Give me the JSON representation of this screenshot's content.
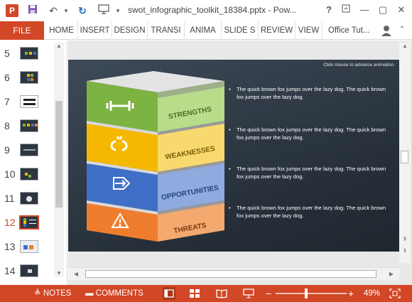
{
  "window": {
    "title": "swot_infographic_toolkit_18384.pptx - Pow...",
    "app_icon_label": "P",
    "quick_access": [
      "save-icon",
      "undo-icon",
      "redo-icon",
      "present-icon"
    ],
    "controls": [
      "help-icon",
      "ribbon-display-icon",
      "minimize-icon",
      "maximize-icon",
      "close-icon"
    ]
  },
  "ribbon": {
    "file_label": "FILE",
    "tabs": [
      "HOME",
      "INSERT",
      "DESIGN",
      "TRANSI",
      "ANIMA",
      "SLIDE S",
      "REVIEW",
      "VIEW"
    ],
    "user": "Office Tut..."
  },
  "thumbnails": {
    "items": [
      {
        "num": "5"
      },
      {
        "num": "6"
      },
      {
        "num": "7"
      },
      {
        "num": "8"
      },
      {
        "num": "9"
      },
      {
        "num": "10"
      },
      {
        "num": "11"
      },
      {
        "num": "12"
      },
      {
        "num": "13"
      },
      {
        "num": "14"
      }
    ],
    "active": "12"
  },
  "slide": {
    "hint": "Click mouse to advance animation.",
    "layers": [
      {
        "label": "STRENGTHS",
        "color": "#7cb342",
        "side": "#b7dc8a",
        "icon": "dumbbell-icon"
      },
      {
        "label": "WEAKNESSES",
        "color": "#f5b800",
        "side": "#f8d96e",
        "icon": "broken-link-icon"
      },
      {
        "label": "OPPORTUNITIES",
        "color": "#3f6fc6",
        "side": "#8eaadf",
        "icon": "arrow-right-icon"
      },
      {
        "label": "THREATS",
        "color": "#ef7d2e",
        "side": "#f4a96e",
        "icon": "warning-icon"
      }
    ],
    "bullets": [
      "The quick brown fox jumps over the lazy dog. The quick brown fox jumps over the lazy dog.",
      "The quick brown fox jumps over the lazy dog. The quick brown fox jumps over the lazy dog.",
      "The quick brown fox jumps over the lazy dog. The quick brown fox jumps over the lazy dog.",
      "The quick brown fox jumps over the lazy dog. The quick brown fox jumps over the lazy dog."
    ]
  },
  "statusbar": {
    "notes_label": "NOTES",
    "comments_label": "COMMENTS",
    "zoom": "49%",
    "zoom_value": 49,
    "views": [
      "normal-view-icon",
      "slide-sorter-icon",
      "reading-view-icon",
      "slideshow-icon"
    ]
  },
  "colors": {
    "accent": "#d24726",
    "slide_bg": "#2b343e"
  }
}
